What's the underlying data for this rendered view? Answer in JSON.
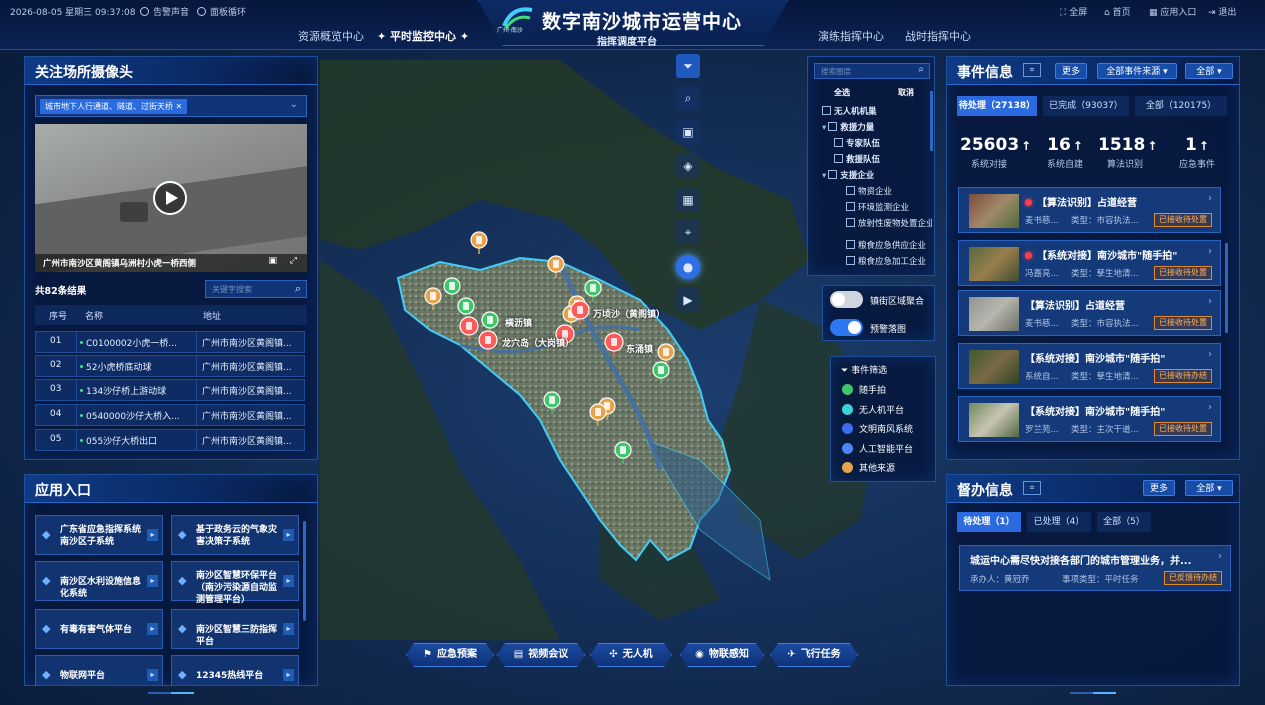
{
  "header": {
    "date": "2026-08-05 星期三 09:37:08",
    "alarm_sound": "告警声音",
    "panel_loop": "面板循环",
    "logo_text": "广州·南沙",
    "title": "数字南沙城市运营中心",
    "subtitle": "指挥调度平台",
    "fullscreen": "全屏",
    "home": "首页",
    "app_entry": "应用入口",
    "exit": "退出",
    "nav": [
      "资源概览中心",
      "平时监控中心",
      "演练指挥中心",
      "战时指挥中心"
    ]
  },
  "camera_panel": {
    "title": "关注场所摄像头",
    "filter_tag": "城市地下人行通道、隧道、过街天桥",
    "video_caption": "广州市南沙区黄阁镇乌洲村小虎一桥西侧",
    "result_count": "共82条结果",
    "search_placeholder": "关键字搜索",
    "columns": [
      "序号",
      "名称",
      "地址"
    ],
    "rows": [
      {
        "no": "01",
        "name": "C0100002小虎一桥...",
        "addr": "广州市南沙区黄阁镇..."
      },
      {
        "no": "02",
        "name": "52小虎桥底动球",
        "addr": "广州市南沙区黄阁镇..."
      },
      {
        "no": "03",
        "name": "134沙仔桥上游动球",
        "addr": "广州市南沙区黄阁镇..."
      },
      {
        "no": "04",
        "name": "0540000沙仔大桥入...",
        "addr": "广州市南沙区黄阁镇..."
      },
      {
        "no": "05",
        "name": "055沙仔大桥出口",
        "addr": "广州市南沙区黄阁镇..."
      }
    ]
  },
  "app_panel": {
    "title": "应用入口",
    "items": [
      "广东省应急指挥系统南沙区子系统",
      "基于政务云的气象灾害决策子系统",
      "南沙区水利设施信息化系统",
      "南沙区智慧环保平台（南沙污染源自动监测管理平台）",
      "有毒有害气体平台",
      "南沙区智慧三防指挥平台",
      "物联网平台",
      "12345热线平台"
    ]
  },
  "layers": {
    "search_placeholder": "搜索图层",
    "select_all": "全选",
    "cancel": "取消",
    "items": [
      {
        "label": "无人机机巢",
        "level": 0
      },
      {
        "label": "救援力量",
        "level": 0
      },
      {
        "label": "专家队伍",
        "level": 1
      },
      {
        "label": "救援队伍",
        "level": 1
      },
      {
        "label": "支援企业",
        "level": 0
      },
      {
        "label": "物资企业",
        "level": 2
      },
      {
        "label": "环境监测企业",
        "level": 2
      },
      {
        "label": "放射性废物处置企业",
        "level": 2
      },
      {
        "label": "粮食应急供应企业",
        "level": 2
      },
      {
        "label": "粮食应急加工企业",
        "level": 2
      }
    ]
  },
  "toggles": [
    {
      "label": "镇街区域聚合",
      "on": false
    },
    {
      "label": "预警落图",
      "on": true
    }
  ],
  "legend": {
    "title": "事件筛选",
    "items": [
      {
        "label": "随手拍",
        "color": "#3fc66a"
      },
      {
        "label": "无人机平台",
        "color": "#3bd1d6"
      },
      {
        "label": "文明南风系统",
        "color": "#3b6cf0"
      },
      {
        "label": "人工智能平台",
        "color": "#4d86f2"
      },
      {
        "label": "其他来源",
        "color": "#e7a24b"
      }
    ]
  },
  "map_labels": [
    "横沥镇",
    "万顷沙（黄阁镇）",
    "龙穴岛（大岗镇）",
    "东涌镇",
    "榄核镇",
    "南沙街"
  ],
  "bottom_buttons": [
    "应急预案",
    "视频会议",
    "无人机",
    "物联感知",
    "飞行任务"
  ],
  "event_panel": {
    "title": "事件信息",
    "more": "更多",
    "source_select": "全部事件来源",
    "all_select": "全部",
    "tabs": [
      "待处理（27138）",
      "已完成（93037）",
      "全部（120175）"
    ],
    "stats": [
      {
        "value": "25603",
        "label": "系统对接"
      },
      {
        "value": "16",
        "label": "系统自建"
      },
      {
        "value": "1518",
        "label": "算法识别"
      },
      {
        "value": "1",
        "label": "应急事件"
      }
    ],
    "events": [
      {
        "title": "【算法识别】占道经营",
        "left": "麦书慈...",
        "type": "类型：市容执法...",
        "tag": "已接收待处置",
        "dot": true
      },
      {
        "title": "【系统对接】南沙城市\"随手拍\"",
        "left": "冯嘉亮...",
        "type": "类型：孳生地清...",
        "tag": "已接收待处置",
        "dot": true
      },
      {
        "title": "【算法识别】占道经营",
        "left": "麦书慈...",
        "type": "类型：市容执法...",
        "tag": "已接收待处置",
        "dot": false
      },
      {
        "title": "【系统对接】南沙城市\"随手拍\"",
        "left": "系统自...",
        "type": "类型：孳生地清...",
        "tag": "已接收待办结",
        "dot": false
      },
      {
        "title": "【系统对接】南沙城市\"随手拍\"",
        "left": "罗兰苑...",
        "type": "类型：主次干道...",
        "tag": "已接收待处置",
        "dot": false
      }
    ]
  },
  "supervise_panel": {
    "title": "督办信息",
    "more": "更多",
    "all_select": "全部",
    "tabs": [
      "待处理（1）",
      "已处理（4）",
      "全部（5）"
    ],
    "item": {
      "title": "城运中心需尽快对接各部门的城市管理业务，并...",
      "owner": "承办人：黄冠乔",
      "type": "事项类型：平时任务",
      "tag": "已反馈待办结"
    }
  }
}
